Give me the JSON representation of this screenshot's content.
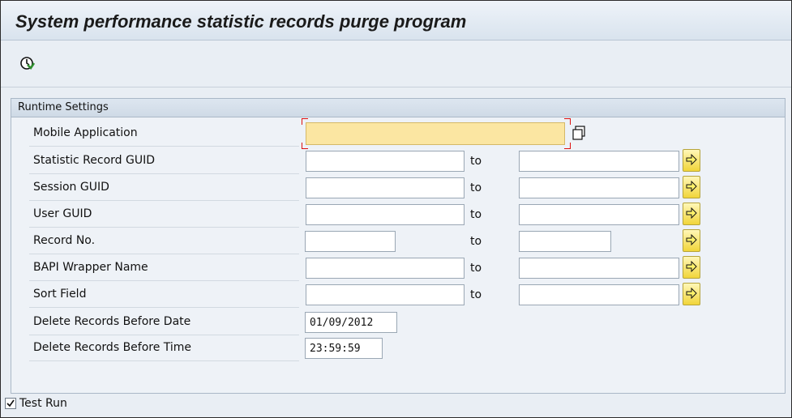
{
  "window": {
    "title": "System performance statistic records purge program"
  },
  "toolbar": {
    "execute_icon": "execute-clock-icon"
  },
  "runtime_settings": {
    "group_title": "Runtime Settings",
    "mobile_application": {
      "label": "Mobile Application",
      "value": "",
      "copy_icon": "copy-icon"
    },
    "range_to_label": "to",
    "fields": [
      {
        "label": "Statistic Record GUID",
        "from": "",
        "to": ""
      },
      {
        "label": "Session GUID",
        "from": "",
        "to": ""
      },
      {
        "label": "User GUID",
        "from": "",
        "to": ""
      },
      {
        "label": "Record No.",
        "from": "",
        "to": ""
      },
      {
        "label": "BAPI Wrapper Name",
        "from": "",
        "to": ""
      },
      {
        "label": "Sort Field",
        "from": "",
        "to": ""
      }
    ],
    "delete_before_date": {
      "label": "Delete Records Before Date",
      "value": "01/09/2012"
    },
    "delete_before_time": {
      "label": "Delete Records Before Time",
      "value": "23:59:59"
    }
  },
  "options": {
    "test_run": {
      "label": "Test Run",
      "checked": true
    }
  },
  "colors": {
    "mandatory_field_bg": "#fbe6a2",
    "multi_select_button": "#f1d53a",
    "panel_bg": "#e9eef4"
  }
}
